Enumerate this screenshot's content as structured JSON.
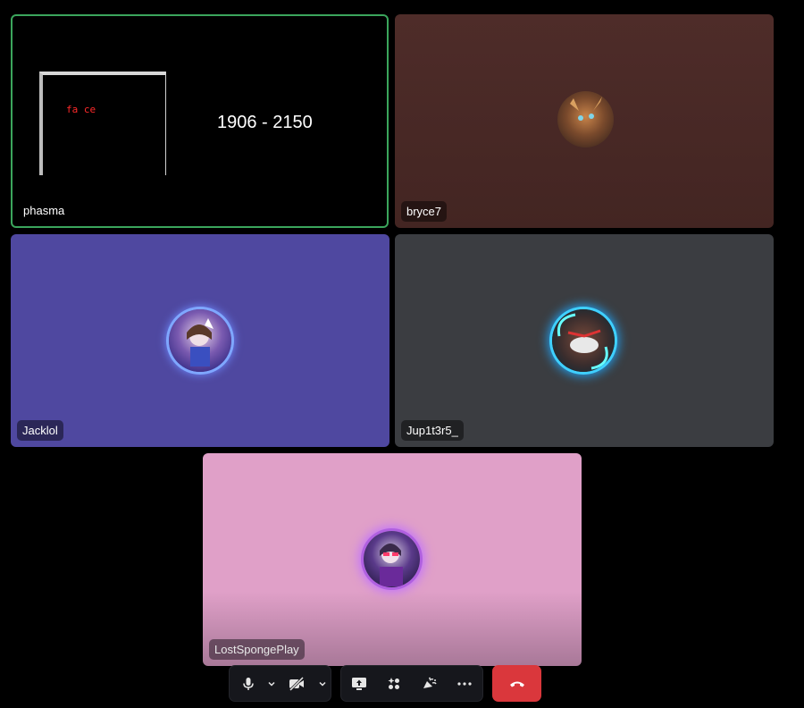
{
  "participants": [
    {
      "name": "phasma",
      "bg": "#000000",
      "speaking": true,
      "screen_label": "fa ce",
      "screen_text": "1906 - 2150"
    },
    {
      "name": "bryce7",
      "bg": "#4a2926"
    },
    {
      "name": "Jacklol",
      "bg": "#4f48a0"
    },
    {
      "name": "Jup1t3r5_",
      "bg": "#3b3d41"
    },
    {
      "name": "LostSpongePlay",
      "bg": "#e0a0c8"
    }
  ],
  "controls": {
    "mic_icon": "microphone-icon",
    "camera_icon": "camera-off-icon",
    "screen_icon": "screen-share-icon",
    "activity_icon": "activities-icon",
    "soundboard_icon": "soundboard-icon",
    "more_icon": "more-icon",
    "disconnect_icon": "hang-up-icon",
    "disconnect_color": "#da373c"
  }
}
